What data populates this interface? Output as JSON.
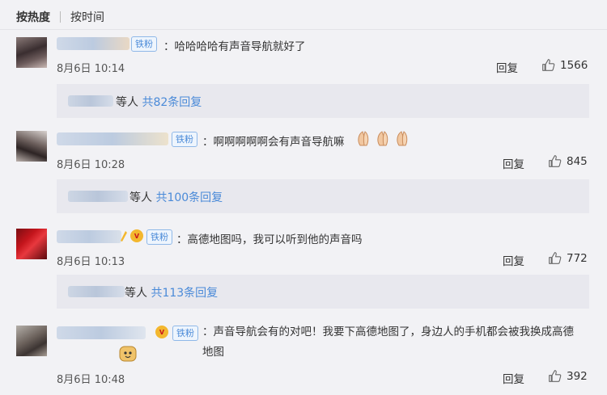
{
  "tabs": [
    {
      "label": "按热度",
      "active": true
    },
    {
      "label": "按时间",
      "active": false
    }
  ],
  "badge_label": "铁粉",
  "colors": {
    "link": "#4a8ad8",
    "badge_border": "#8fb8e8",
    "background": "#f2f2f5"
  },
  "comments": [
    {
      "text": "哈哈哈哈有声音导航就好了",
      "date": "8月6日",
      "time": "10:14",
      "reply_label": "回复",
      "likes": "1566",
      "sub_prefix": "等人",
      "sub_link": "共82条回复"
    },
    {
      "text": "啊啊啊啊啊会有声音导航嘛",
      "date": "8月6日",
      "time": "10:28",
      "reply_label": "回复",
      "likes": "845",
      "sub_prefix": "等人",
      "sub_link": "共100条回复"
    },
    {
      "text": "高德地图吗，我可以听到他的声音吗",
      "date": "8月6日",
      "time": "10:13",
      "reply_label": "回复",
      "likes": "772",
      "sub_prefix": "等人",
      "sub_link": "共113条回复"
    },
    {
      "text": "声音导航会有的对吧！我要下高德地图了，身边人的手机都会被我换成高德地图",
      "date": "8月6日",
      "time": "10:48",
      "reply_label": "回复",
      "likes": "392"
    }
  ]
}
